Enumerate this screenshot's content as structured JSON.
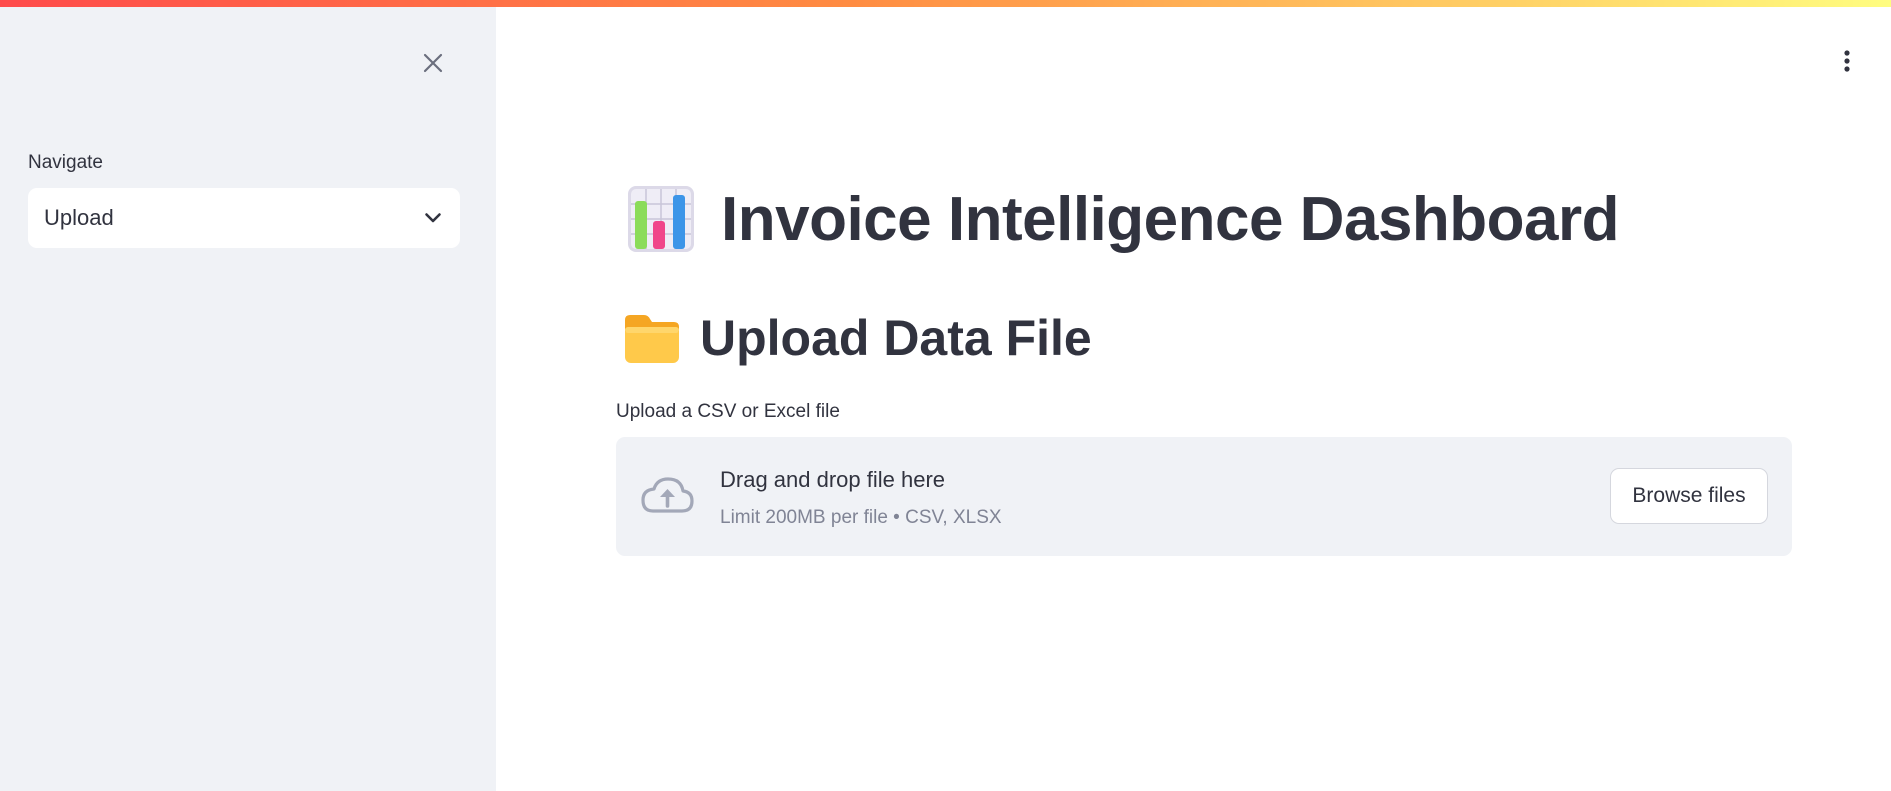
{
  "sidebar": {
    "close_icon": "close-icon",
    "nav_label": "Navigate",
    "nav_select": {
      "selected": "Upload",
      "chevron_icon": "chevron-down-icon"
    }
  },
  "header": {
    "menu_icon": "vertical-ellipsis-icon"
  },
  "main": {
    "title": "Invoice Intelligence Dashboard",
    "title_emoji": "bar-chart-emoji",
    "section_title": "Upload Data File",
    "section_emoji": "folder-emoji",
    "uploader": {
      "label": "Upload a CSV or Excel file",
      "drop_text": "Drag and drop file here",
      "limit_text": "Limit 200MB per file • CSV, XLSX",
      "browse_label": "Browse files",
      "icon": "cloud-upload-icon"
    }
  },
  "colors": {
    "sidebar_bg": "#f0f2f6",
    "text": "#31333f",
    "muted_text": "#808495",
    "dropzone_bg": "#f0f2f6",
    "accent_gradient_start": "#ff4b4b",
    "accent_gradient_end": "#fffd80"
  }
}
